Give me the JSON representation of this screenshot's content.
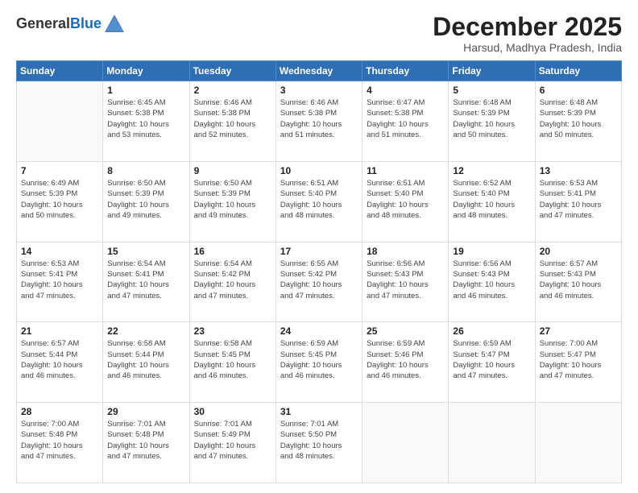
{
  "logo": {
    "general": "General",
    "blue": "Blue"
  },
  "title": "December 2025",
  "subtitle": "Harsud, Madhya Pradesh, India",
  "weekdays": [
    "Sunday",
    "Monday",
    "Tuesday",
    "Wednesday",
    "Thursday",
    "Friday",
    "Saturday"
  ],
  "weeks": [
    [
      {
        "day": "",
        "info": ""
      },
      {
        "day": "1",
        "info": "Sunrise: 6:45 AM\nSunset: 5:38 PM\nDaylight: 10 hours\nand 53 minutes."
      },
      {
        "day": "2",
        "info": "Sunrise: 6:46 AM\nSunset: 5:38 PM\nDaylight: 10 hours\nand 52 minutes."
      },
      {
        "day": "3",
        "info": "Sunrise: 6:46 AM\nSunset: 5:38 PM\nDaylight: 10 hours\nand 51 minutes."
      },
      {
        "day": "4",
        "info": "Sunrise: 6:47 AM\nSunset: 5:38 PM\nDaylight: 10 hours\nand 51 minutes."
      },
      {
        "day": "5",
        "info": "Sunrise: 6:48 AM\nSunset: 5:39 PM\nDaylight: 10 hours\nand 50 minutes."
      },
      {
        "day": "6",
        "info": "Sunrise: 6:48 AM\nSunset: 5:39 PM\nDaylight: 10 hours\nand 50 minutes."
      }
    ],
    [
      {
        "day": "7",
        "info": "Sunrise: 6:49 AM\nSunset: 5:39 PM\nDaylight: 10 hours\nand 50 minutes."
      },
      {
        "day": "8",
        "info": "Sunrise: 6:50 AM\nSunset: 5:39 PM\nDaylight: 10 hours\nand 49 minutes."
      },
      {
        "day": "9",
        "info": "Sunrise: 6:50 AM\nSunset: 5:39 PM\nDaylight: 10 hours\nand 49 minutes."
      },
      {
        "day": "10",
        "info": "Sunrise: 6:51 AM\nSunset: 5:40 PM\nDaylight: 10 hours\nand 48 minutes."
      },
      {
        "day": "11",
        "info": "Sunrise: 6:51 AM\nSunset: 5:40 PM\nDaylight: 10 hours\nand 48 minutes."
      },
      {
        "day": "12",
        "info": "Sunrise: 6:52 AM\nSunset: 5:40 PM\nDaylight: 10 hours\nand 48 minutes."
      },
      {
        "day": "13",
        "info": "Sunrise: 6:53 AM\nSunset: 5:41 PM\nDaylight: 10 hours\nand 47 minutes."
      }
    ],
    [
      {
        "day": "14",
        "info": "Sunrise: 6:53 AM\nSunset: 5:41 PM\nDaylight: 10 hours\nand 47 minutes."
      },
      {
        "day": "15",
        "info": "Sunrise: 6:54 AM\nSunset: 5:41 PM\nDaylight: 10 hours\nand 47 minutes."
      },
      {
        "day": "16",
        "info": "Sunrise: 6:54 AM\nSunset: 5:42 PM\nDaylight: 10 hours\nand 47 minutes."
      },
      {
        "day": "17",
        "info": "Sunrise: 6:55 AM\nSunset: 5:42 PM\nDaylight: 10 hours\nand 47 minutes."
      },
      {
        "day": "18",
        "info": "Sunrise: 6:56 AM\nSunset: 5:43 PM\nDaylight: 10 hours\nand 47 minutes."
      },
      {
        "day": "19",
        "info": "Sunrise: 6:56 AM\nSunset: 5:43 PM\nDaylight: 10 hours\nand 46 minutes."
      },
      {
        "day": "20",
        "info": "Sunrise: 6:57 AM\nSunset: 5:43 PM\nDaylight: 10 hours\nand 46 minutes."
      }
    ],
    [
      {
        "day": "21",
        "info": "Sunrise: 6:57 AM\nSunset: 5:44 PM\nDaylight: 10 hours\nand 46 minutes."
      },
      {
        "day": "22",
        "info": "Sunrise: 6:58 AM\nSunset: 5:44 PM\nDaylight: 10 hours\nand 46 minutes."
      },
      {
        "day": "23",
        "info": "Sunrise: 6:58 AM\nSunset: 5:45 PM\nDaylight: 10 hours\nand 46 minutes."
      },
      {
        "day": "24",
        "info": "Sunrise: 6:59 AM\nSunset: 5:45 PM\nDaylight: 10 hours\nand 46 minutes."
      },
      {
        "day": "25",
        "info": "Sunrise: 6:59 AM\nSunset: 5:46 PM\nDaylight: 10 hours\nand 46 minutes."
      },
      {
        "day": "26",
        "info": "Sunrise: 6:59 AM\nSunset: 5:47 PM\nDaylight: 10 hours\nand 47 minutes."
      },
      {
        "day": "27",
        "info": "Sunrise: 7:00 AM\nSunset: 5:47 PM\nDaylight: 10 hours\nand 47 minutes."
      }
    ],
    [
      {
        "day": "28",
        "info": "Sunrise: 7:00 AM\nSunset: 5:48 PM\nDaylight: 10 hours\nand 47 minutes."
      },
      {
        "day": "29",
        "info": "Sunrise: 7:01 AM\nSunset: 5:48 PM\nDaylight: 10 hours\nand 47 minutes."
      },
      {
        "day": "30",
        "info": "Sunrise: 7:01 AM\nSunset: 5:49 PM\nDaylight: 10 hours\nand 47 minutes."
      },
      {
        "day": "31",
        "info": "Sunrise: 7:01 AM\nSunset: 5:50 PM\nDaylight: 10 hours\nand 48 minutes."
      },
      {
        "day": "",
        "info": ""
      },
      {
        "day": "",
        "info": ""
      },
      {
        "day": "",
        "info": ""
      }
    ]
  ]
}
